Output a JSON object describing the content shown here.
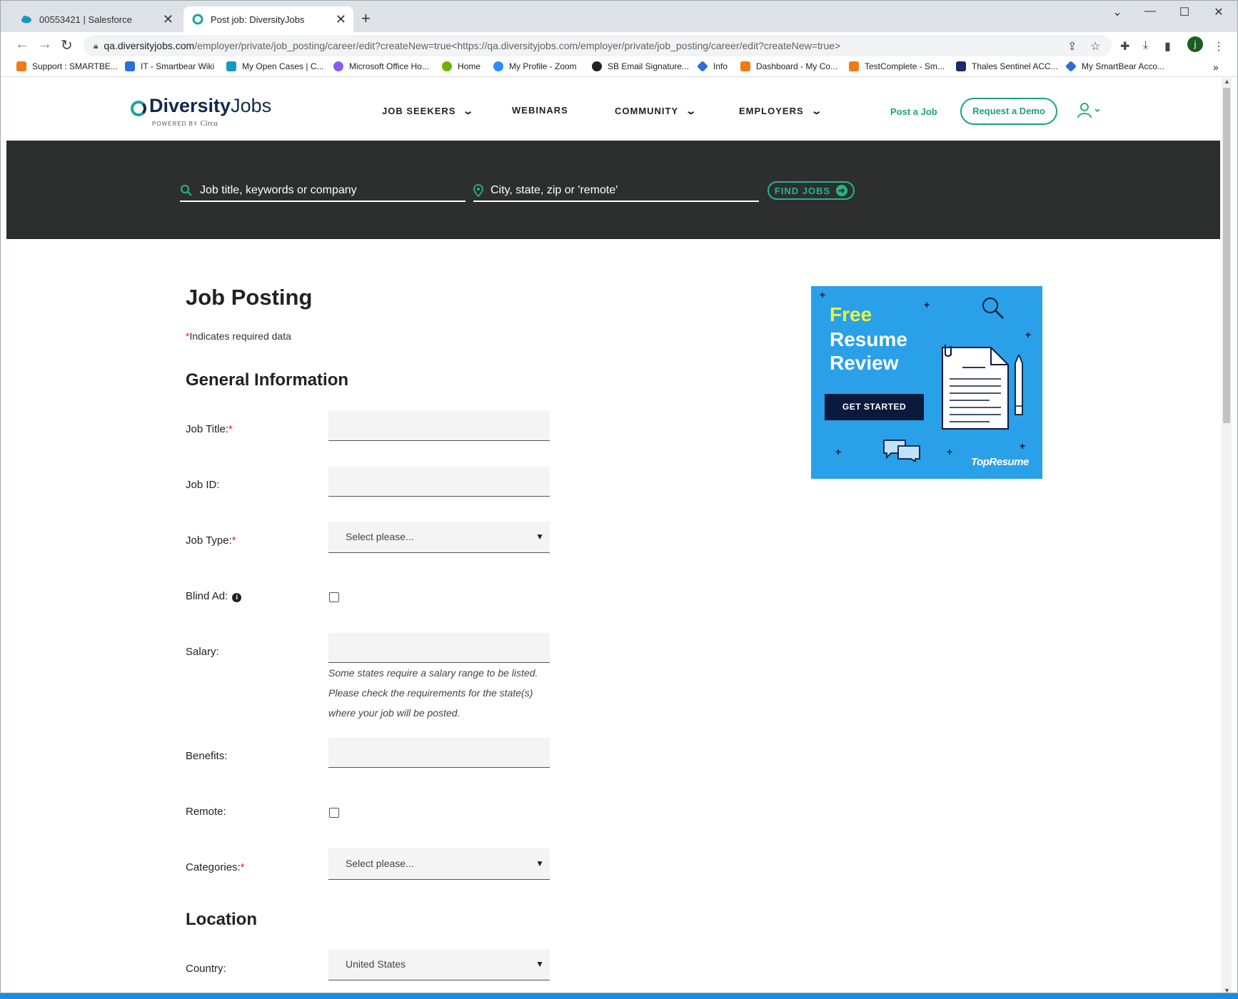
{
  "browser": {
    "tabs": [
      {
        "title": "00553421 | Salesforce",
        "active": false
      },
      {
        "title": "Post job: DiversityJobs",
        "active": true
      }
    ],
    "url_host": "qa.diversityjobs.com",
    "url_path": "/employer/private/job_posting/career/edit?createNew=true<https://qa.diversityjobs.com/employer/private/job_posting/career/edit?createNew=true>",
    "profile_initial": "j",
    "bookmarks": [
      {
        "label": "Support : SMARTBE...",
        "color": "#f07a1a"
      },
      {
        "label": "IT - Smartbear Wiki",
        "color": "#2a6fdb"
      },
      {
        "label": "My Open Cases | C...",
        "color": "#1798c1"
      },
      {
        "label": "Microsoft Office Ho...",
        "color": "#8a5cf5"
      },
      {
        "label": "Home",
        "color": "#6bb300"
      },
      {
        "label": "My Profile - Zoom",
        "color": "#2d8cff"
      },
      {
        "label": "SB Email Signature...",
        "color": "#222222"
      },
      {
        "label": "Info",
        "color": "#2a6fdb"
      },
      {
        "label": "Dashboard - My Co...",
        "color": "#f07a1a"
      },
      {
        "label": "TestComplete - Sm...",
        "color": "#f07a1a"
      },
      {
        "label": "Thales Sentinel ACC...",
        "color": "#1b2a6b"
      },
      {
        "label": "My SmartBear Acco...",
        "color": "#2a6fdb"
      }
    ]
  },
  "site": {
    "logo_bold": "Diversity",
    "logo_light": "Jobs",
    "logo_sub": "POWERED BY",
    "logo_sub_brand": "Circa",
    "nav": {
      "job_seekers": "JOB SEEKERS",
      "webinars": "WEBINARS",
      "community": "COMMUNITY",
      "employers": "EMPLOYERS"
    },
    "post_job": "Post a Job",
    "request_demo": "Request a Demo",
    "search": {
      "keywords_placeholder": "Job title, keywords or company",
      "location_placeholder": "City, state, zip or 'remote'",
      "find_jobs": "FIND JOBS"
    }
  },
  "form": {
    "title": "Job Posting",
    "required_note": "Indicates required data",
    "section_general": "General Information",
    "labels": {
      "job_title": "Job Title:",
      "job_id": "Job ID:",
      "job_type": "Job Type:",
      "blind_ad": "Blind Ad:",
      "salary": "Salary:",
      "benefits": "Benefits:",
      "remote": "Remote:",
      "categories": "Categories:",
      "country": "Country:"
    },
    "job_type_value": "Select please...",
    "categories_value": "Select please...",
    "salary_hint": "Some states require a salary range to be listed. Please check the requirements for the state(s) where your job will be posted.",
    "section_location": "Location",
    "country_value": "United States",
    "blind_ad_checked": false,
    "remote_checked": false
  },
  "ad": {
    "line1": "Free",
    "line2": "Resume",
    "line3": "Review",
    "cta": "GET STARTED",
    "brand": "TopResume"
  }
}
